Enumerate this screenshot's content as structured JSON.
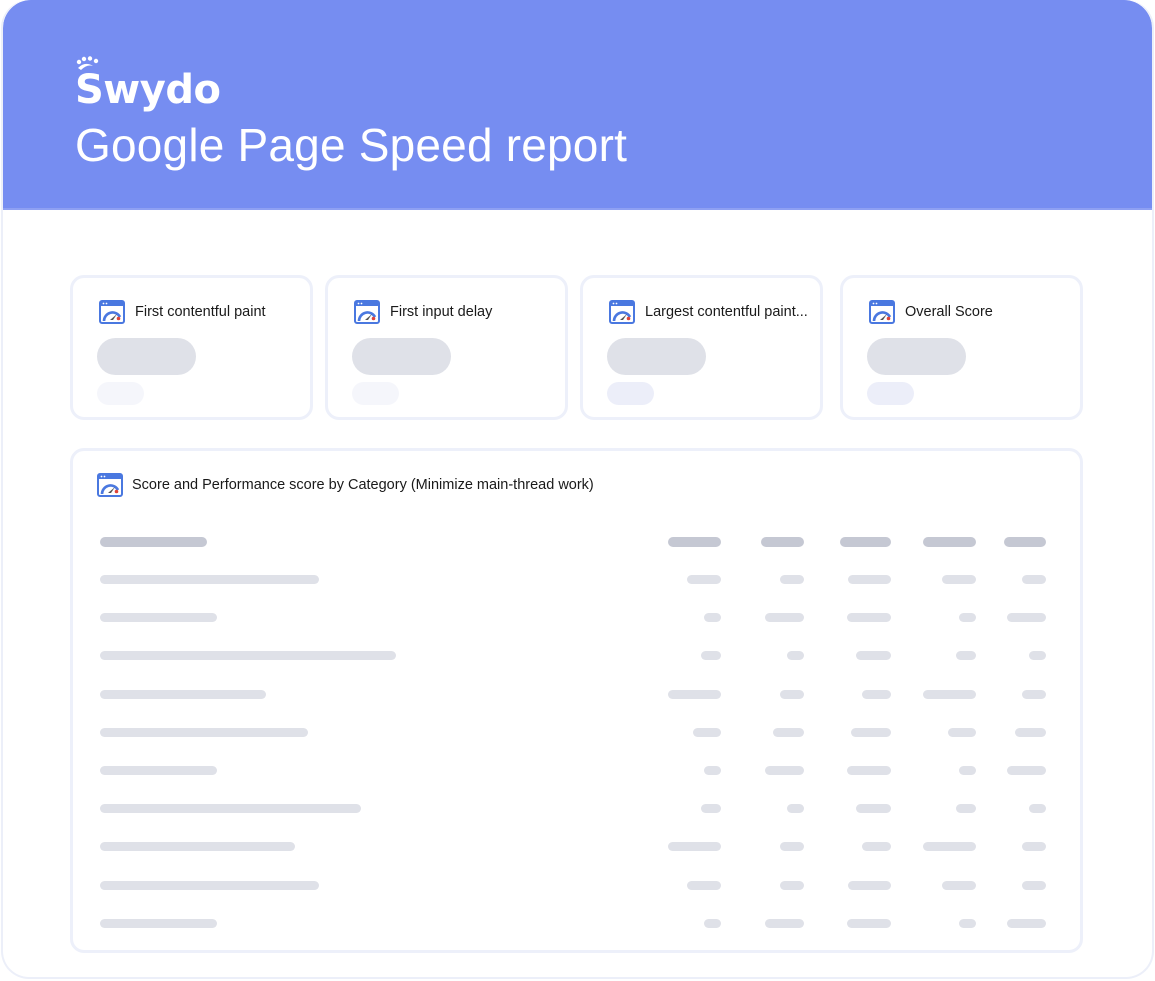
{
  "brand": {
    "logo_text": "Swydo",
    "accent_color": "#768df1"
  },
  "header": {
    "title": "Google Page Speed report"
  },
  "kpi_cards": [
    {
      "label": "First contentful paint",
      "icon": "pagespeed-gauge-icon",
      "value": "",
      "change": ""
    },
    {
      "label": "First input delay",
      "icon": "pagespeed-gauge-icon",
      "value": "",
      "change": ""
    },
    {
      "label": "Largest contentful paint...",
      "icon": "pagespeed-gauge-icon",
      "value": "",
      "change": ""
    },
    {
      "label": "Overall Score",
      "icon": "pagespeed-gauge-icon",
      "value": "",
      "change": ""
    }
  ],
  "table": {
    "title": "Score and Performance score by Category (Minimize main-thread work)",
    "icon": "pagespeed-gauge-icon",
    "state": "loading-placeholder",
    "column_count": 6,
    "row_count": 10
  },
  "colors": {
    "header_bg": "#768df1",
    "placeholder": "#dfe1e8",
    "placeholder_header": "#c5c8d3",
    "card_border": "#edf0fa"
  }
}
